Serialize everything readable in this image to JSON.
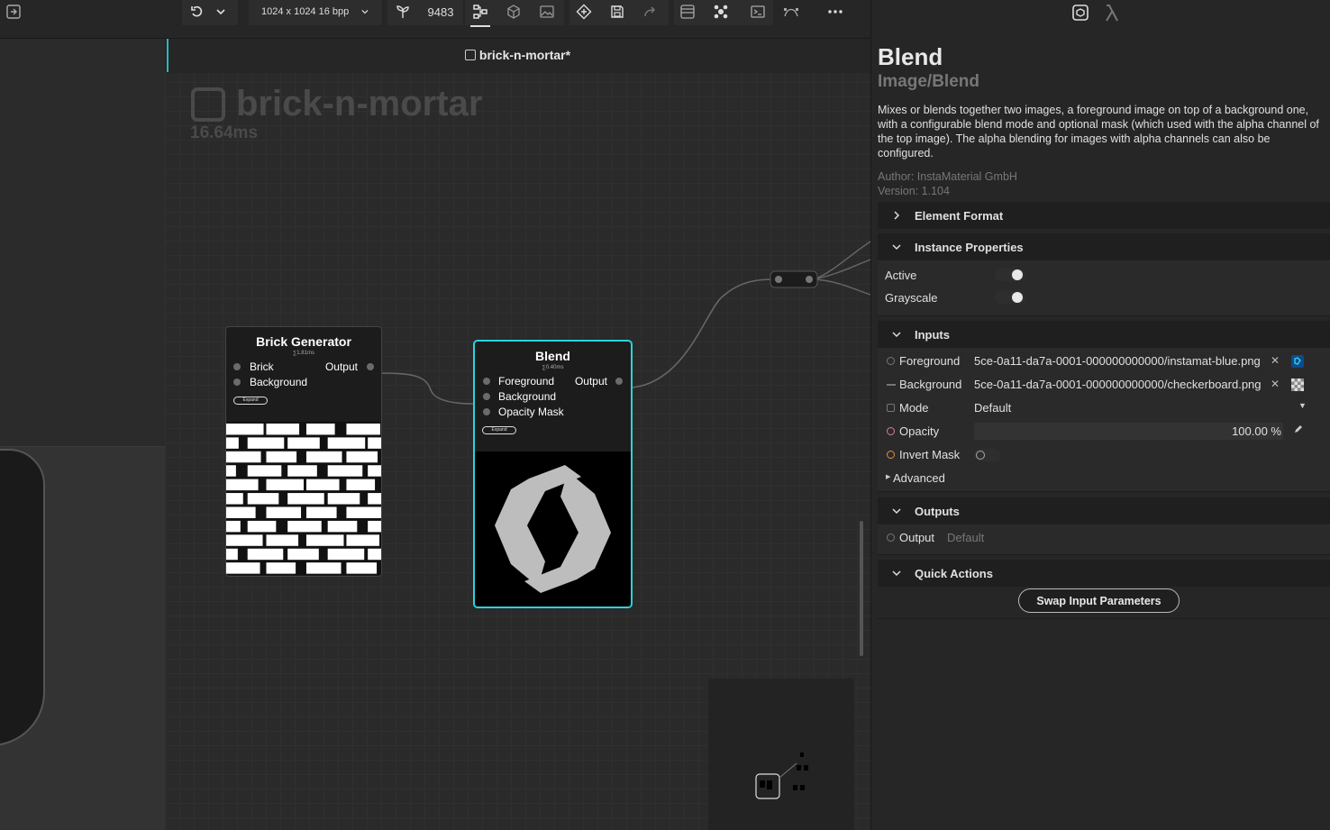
{
  "toolbar": {
    "resolution": "1024 x 1024 16 bpp",
    "seed": "9483"
  },
  "document": {
    "tab_title": "brick-n-mortar*",
    "graph_name": "brick-n-mortar",
    "graph_time": "16.64ms"
  },
  "nodes": {
    "brick_generator": {
      "title": "Brick Generator",
      "time": "∑1.81ms",
      "inputs": [
        "Brick",
        "Background"
      ],
      "output": "Output",
      "expand": "Expand"
    },
    "blend": {
      "title": "Blend",
      "time": "∑0.40ms",
      "inputs": [
        "Foreground",
        "Background",
        "Opacity Mask"
      ],
      "output": "Output",
      "expand": "Expand"
    }
  },
  "panel": {
    "node_name": "Blend",
    "node_path": "Image/Blend",
    "description": "Mixes or blends together two images, a foreground image on top of a background one, with a configurable blend mode and optional mask (which used with the alpha channel of the top image). The alpha blending for images with alpha channels can also be configured.",
    "author": "Author: InstaMaterial GmbH",
    "version": "Version: 1.104",
    "sections": {
      "element_format": "Element Format",
      "instance_properties": "Instance Properties",
      "inputs": "Inputs",
      "outputs": "Outputs",
      "quick_actions": "Quick Actions"
    },
    "instance": {
      "active_label": "Active",
      "grayscale_label": "Grayscale"
    },
    "inputs": {
      "foreground_label": "Foreground",
      "foreground_value": "5ce-0a11-da7a-0001-000000000000/instamat-blue.png",
      "background_label": "Background",
      "background_value": "5ce-0a11-da7a-0001-000000000000/checkerboard.png",
      "mode_label": "Mode",
      "mode_value": "Default",
      "opacity_label": "Opacity",
      "opacity_value": "100.00 %",
      "invert_mask_label": "Invert Mask",
      "advanced_label": "Advanced"
    },
    "outputs": {
      "output_label": "Output",
      "output_value": "Default"
    },
    "quick_actions": {
      "swap_label": "Swap Input Parameters"
    }
  },
  "colors": {
    "accent": "#2ad3de",
    "panel_bg": "#262626",
    "canvas_bg": "#2a2a2a"
  }
}
